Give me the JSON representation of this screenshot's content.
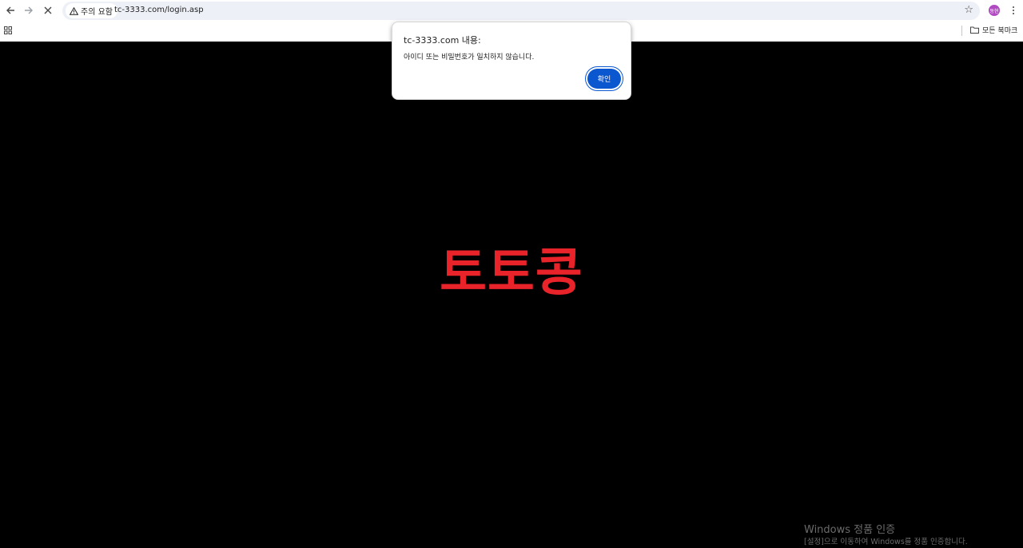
{
  "browser": {
    "security_label": "주의 요함",
    "url": "tc-3333.com/login.asp",
    "avatar_text": "동현",
    "bookmarks_all_label": "모든 북마크"
  },
  "page": {
    "brand_text": "토토콩",
    "brand_color": "#e8232a",
    "background_color": "#000000"
  },
  "dialog": {
    "title": "tc-3333.com 내용:",
    "message": "아이디 또는 비밀번호가 일치하지 않습니다.",
    "ok_label": "확인",
    "button_color": "#0b57d0"
  },
  "watermark": {
    "title": "Windows 정품 인증",
    "subtitle": "[설정]으로 이동하여 Windows를 정품 인증합니다."
  },
  "icons": [
    "back-arrow-icon",
    "forward-arrow-icon",
    "stop-loading-icon",
    "warning-triangle-icon",
    "star-bookmark-icon",
    "kebab-menu-icon",
    "apps-grid-icon",
    "folder-icon"
  ]
}
